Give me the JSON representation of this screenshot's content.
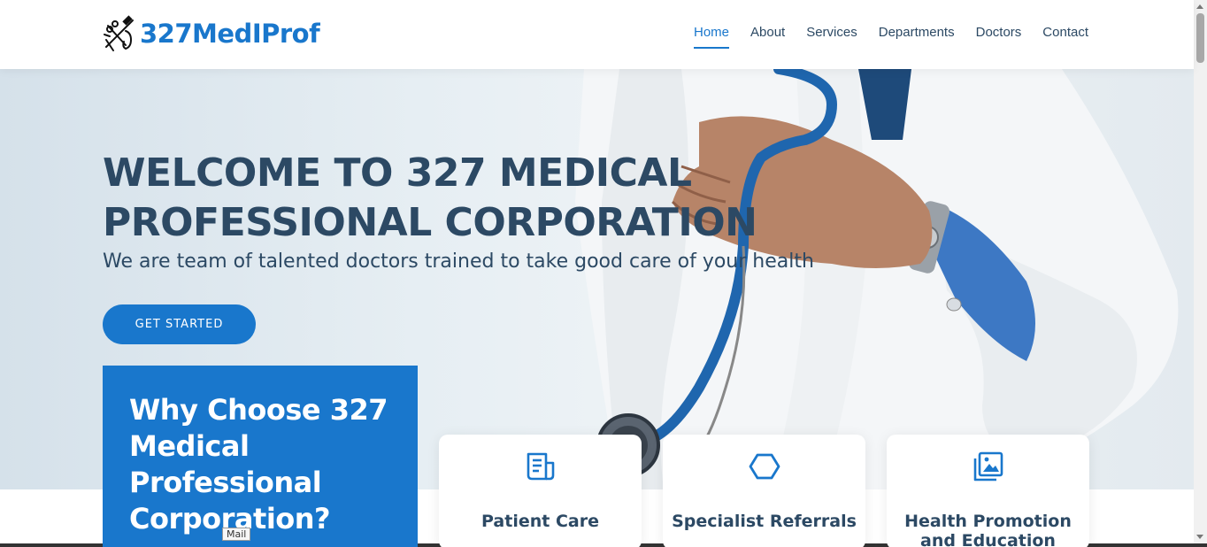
{
  "brand": {
    "name": "327MedIProf",
    "logo_icon": "medical-tools-icon"
  },
  "nav": {
    "items": [
      {
        "label": "Home",
        "active": true
      },
      {
        "label": "About"
      },
      {
        "label": "Services"
      },
      {
        "label": "Departments"
      },
      {
        "label": "Doctors"
      },
      {
        "label": "Contact"
      }
    ]
  },
  "hero": {
    "title": "Welcome to 327 Medical Professional Corporation",
    "subtitle": "We are team of talented doctors trained to take good care of your health",
    "cta_label": "GET STARTED"
  },
  "why": {
    "title": "Why Choose 327 Medical Professional Corporation?"
  },
  "cards": [
    {
      "title": "Patient Care",
      "icon": "receipt-icon"
    },
    {
      "title": "Specialist Referrals",
      "icon": "hexagon-icon"
    },
    {
      "title": "Health Promotion and Education",
      "icon": "image-icon"
    }
  ],
  "tooltip": {
    "text": "Mail"
  },
  "colors": {
    "accent": "#1977cc",
    "heading": "#2c4964"
  }
}
